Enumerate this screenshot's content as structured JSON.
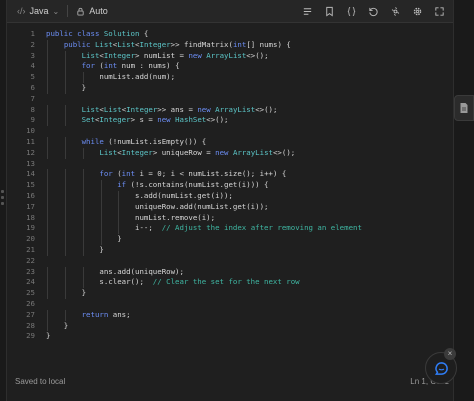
{
  "toolbar": {
    "language": "Java",
    "language_icon": "code-brackets-icon",
    "mode": "Auto",
    "mode_icon": "lock-icon",
    "tools": [
      "notes-icon",
      "bookmark-icon",
      "braces-icon",
      "reset-icon",
      "history-icon",
      "settings-icon",
      "expand-icon"
    ]
  },
  "editor": {
    "line_numbers": [
      "1",
      "2",
      "3",
      "4",
      "5",
      "6",
      "7",
      "8",
      "9",
      "10",
      "11",
      "12",
      "13",
      "14",
      "15",
      "16",
      "17",
      "18",
      "19",
      "20",
      "21",
      "22",
      "23",
      "24",
      "25",
      "26",
      "27",
      "28",
      "29"
    ],
    "lines": [
      "public class Solution {",
      "    public List<List<Integer>> findMatrix(int[] nums) {",
      "        List<Integer> numList = new ArrayList<>();",
      "        for (int num : nums) {",
      "            numList.add(num);",
      "        }",
      "",
      "        List<List<Integer>> ans = new ArrayList<>();",
      "        Set<Integer> s = new HashSet<>();",
      "",
      "        while (!numList.isEmpty()) {",
      "            List<Integer> uniqueRow = new ArrayList<>();",
      "",
      "            for (int i = 0; i < numList.size(); i++) {",
      "                if (!s.contains(numList.get(i))) {",
      "                    s.add(numList.get(i));",
      "                    uniqueRow.add(numList.get(i));",
      "                    numList.remove(i);",
      "                    i--;  // Adjust the index after removing an element",
      "                }",
      "            }",
      "",
      "            ans.add(uniqueRow);",
      "            s.clear();  // Clear the set for the next row",
      "        }",
      "",
      "        return ans;",
      "    }",
      "}"
    ]
  },
  "colors": {
    "keyword": "#6c8ef5",
    "type": "#5cc6c8",
    "comment": "#3fb7a3",
    "text": "#d8d8d8"
  },
  "status": {
    "saved": "Saved to local",
    "cursor": "Ln 1, Col 1"
  },
  "fab_icon": "chat-icon",
  "side_tab_icon": "document-icon"
}
